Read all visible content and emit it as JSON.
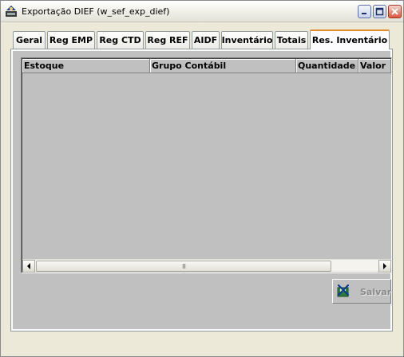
{
  "window": {
    "title": "Exportação DIEF (w_sef_exp_dief)",
    "icons": {
      "app": "app-icon",
      "minimize": "minimize-icon",
      "maximize": "maximize-icon",
      "close": "close-icon"
    }
  },
  "tabs": [
    {
      "label": "Geral",
      "active": false
    },
    {
      "label": "Reg EMP",
      "active": false
    },
    {
      "label": "Reg CTD",
      "active": false
    },
    {
      "label": "Reg REF",
      "active": false
    },
    {
      "label": "AIDF",
      "active": false
    },
    {
      "label": "Inventário",
      "active": false
    },
    {
      "label": "Totais",
      "active": false
    },
    {
      "label": "Res. Inventário",
      "active": true
    }
  ],
  "grid": {
    "columns": [
      "Estoque",
      "Grupo Contábil",
      "Quantidade",
      "Valor"
    ],
    "rows": []
  },
  "scrollbar": {
    "grip": "III"
  },
  "actions": {
    "save_label": "Salvar",
    "save_enabled": false,
    "save_icon": "save-icon"
  },
  "colors": {
    "active_tab_accent": "#e68b2c",
    "panel_gray": "#c0c0c0"
  }
}
